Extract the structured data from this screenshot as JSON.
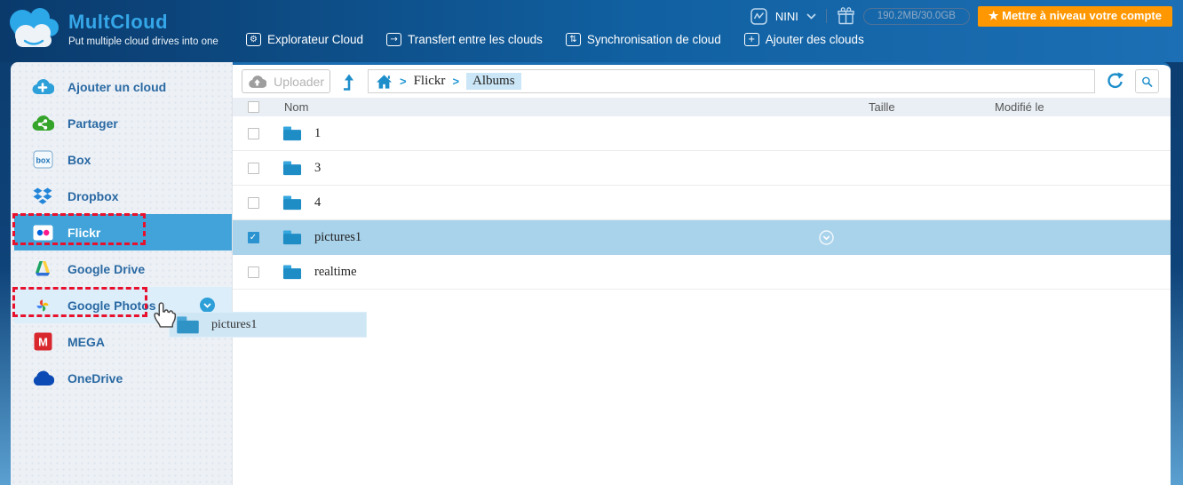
{
  "colors": {
    "accent_blue": "#2196d3",
    "header_gradient_start": "#0a3a6c",
    "header_gradient_end": "#1c6fb4",
    "sidebar_selected_bg": "#41a3da",
    "sidebar_droptarget_bg": "#dceefa",
    "selected_row_bg": "#a9d2eb",
    "upgrade_orange": "#ff9700",
    "annotation_red": "#e8112d",
    "breadcrumb_active_bg": "#cbe6f7"
  },
  "header": {
    "brand": {
      "name": "MultCloud",
      "tagline": "Put multiple cloud drives into one"
    },
    "nav": [
      {
        "label": "Explorateur Cloud",
        "icon": "cloud-explorer-icon",
        "glyph": "⚙"
      },
      {
        "label": "Transfert entre les clouds",
        "icon": "cloud-transfer-icon",
        "glyph": "→"
      },
      {
        "label": "Synchronisation de cloud",
        "icon": "cloud-sync-icon",
        "glyph": "⇅"
      },
      {
        "label": "Ajouter des clouds",
        "icon": "add-clouds-icon",
        "glyph": "+"
      }
    ],
    "user": {
      "name": "NINI"
    },
    "storage": "190.2MB/30.0GB",
    "upgrade_label": "★ Mettre à niveau votre compte"
  },
  "sidebar": {
    "items": [
      {
        "label": "Ajouter un cloud",
        "icon": "add-cloud-icon"
      },
      {
        "label": "Partager",
        "icon": "share-cloud-icon"
      },
      {
        "label": "Box",
        "icon": "box-icon"
      },
      {
        "label": "Dropbox",
        "icon": "dropbox-icon"
      },
      {
        "label": "Flickr",
        "icon": "flickr-icon",
        "selected": true
      },
      {
        "label": "Google Drive",
        "icon": "google-drive-icon"
      },
      {
        "label": "Google Photos",
        "icon": "google-photos-icon",
        "drop_target": true
      },
      {
        "label": "MEGA",
        "icon": "mega-icon"
      },
      {
        "label": "OneDrive",
        "icon": "onedrive-icon"
      }
    ]
  },
  "toolbar": {
    "upload_label": "Uploader",
    "separator": ">",
    "breadcrumb": [
      "Flickr",
      "Albums"
    ]
  },
  "table": {
    "columns": [
      "Nom",
      "Taille",
      "Modifié le"
    ],
    "rows": [
      {
        "name": "1",
        "checked": false
      },
      {
        "name": "3",
        "checked": false
      },
      {
        "name": "4",
        "checked": false
      },
      {
        "name": "pictures1",
        "checked": true,
        "selected": true
      },
      {
        "name": "realtime",
        "checked": false
      }
    ]
  },
  "drag": {
    "ghost_label": "pictures1"
  },
  "icons": {
    "checkmark": "✓"
  }
}
